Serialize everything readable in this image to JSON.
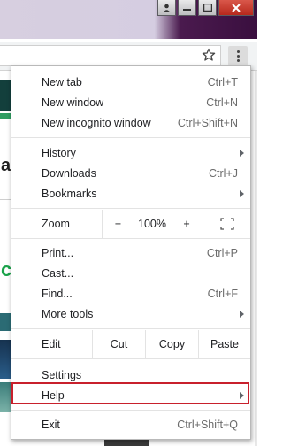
{
  "menu": {
    "new_tab": {
      "label": "New tab",
      "shortcut": "Ctrl+T"
    },
    "new_window": {
      "label": "New window",
      "shortcut": "Ctrl+N"
    },
    "new_incognito": {
      "label": "New incognito window",
      "shortcut": "Ctrl+Shift+N"
    },
    "history": {
      "label": "History"
    },
    "downloads": {
      "label": "Downloads",
      "shortcut": "Ctrl+J"
    },
    "bookmarks": {
      "label": "Bookmarks"
    },
    "zoom": {
      "label": "Zoom",
      "minus": "−",
      "value": "100%",
      "plus": "+"
    },
    "print": {
      "label": "Print...",
      "shortcut": "Ctrl+P"
    },
    "cast": {
      "label": "Cast..."
    },
    "find": {
      "label": "Find...",
      "shortcut": "Ctrl+F"
    },
    "more_tools": {
      "label": "More tools"
    },
    "edit": {
      "label": "Edit",
      "cut": "Cut",
      "copy": "Copy",
      "paste": "Paste"
    },
    "settings": {
      "label": "Settings"
    },
    "help": {
      "label": "Help"
    },
    "exit": {
      "label": "Exit",
      "shortcut": "Ctrl+Shift+Q"
    }
  },
  "background": {
    "letters": [
      "a",
      "c"
    ]
  },
  "icons": {
    "star": "star-icon",
    "menu": "three-dot-menu-icon",
    "fullscreen": "fullscreen-icon",
    "submenu": "chevron-right-icon"
  },
  "colors": {
    "highlight": "#c8202c",
    "titlebar_dark": "#3a0f3f"
  }
}
